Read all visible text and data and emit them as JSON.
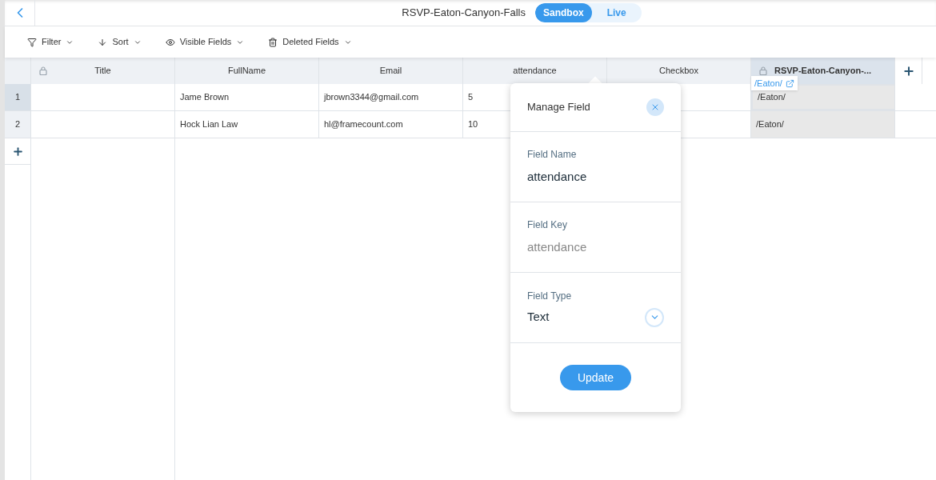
{
  "header": {
    "title": "RSVP-Eaton-Canyon-Falls",
    "modes": [
      {
        "label": "Sandbox",
        "selected": true
      },
      {
        "label": "Live",
        "selected": false
      }
    ]
  },
  "toolbar": [
    {
      "label": "Filter",
      "kind": "filter"
    },
    {
      "label": "Sort",
      "kind": "sort"
    },
    {
      "label": "Visible Fields",
      "kind": "visible"
    },
    {
      "label": "Deleted Fields",
      "kind": "deleted"
    }
  ],
  "table": {
    "columns": [
      {
        "label": "Title",
        "locked": true,
        "kind": "text"
      },
      {
        "label": "FullName",
        "locked": false,
        "kind": "text"
      },
      {
        "label": "Email",
        "locked": false,
        "kind": "text"
      },
      {
        "label": "attendance",
        "locked": false,
        "kind": "text"
      },
      {
        "label": "Checkbox",
        "locked": false,
        "kind": "text"
      },
      {
        "label": "RSVP-Eaton-Canyon-...",
        "locked": true,
        "kind": "url"
      }
    ],
    "link_tooltip": "/Eaton/",
    "rows": [
      {
        "number": "1",
        "selected": true,
        "cells": [
          "",
          "Jame Brown",
          "jbrown3344@gmail.com",
          "5",
          "",
          "/Eaton/"
        ]
      },
      {
        "number": "2",
        "selected": false,
        "cells": [
          "",
          "Hock Lian Law",
          "hl@framecount.com",
          "10",
          "",
          "/Eaton/"
        ]
      }
    ]
  },
  "manage_field": {
    "title": "Manage Field",
    "field_name": {
      "label": "Field Name",
      "value": "attendance"
    },
    "field_key": {
      "label": "Field Key",
      "value": "attendance"
    },
    "field_type": {
      "label": "Field Type",
      "value": "Text"
    },
    "button": "Update"
  }
}
